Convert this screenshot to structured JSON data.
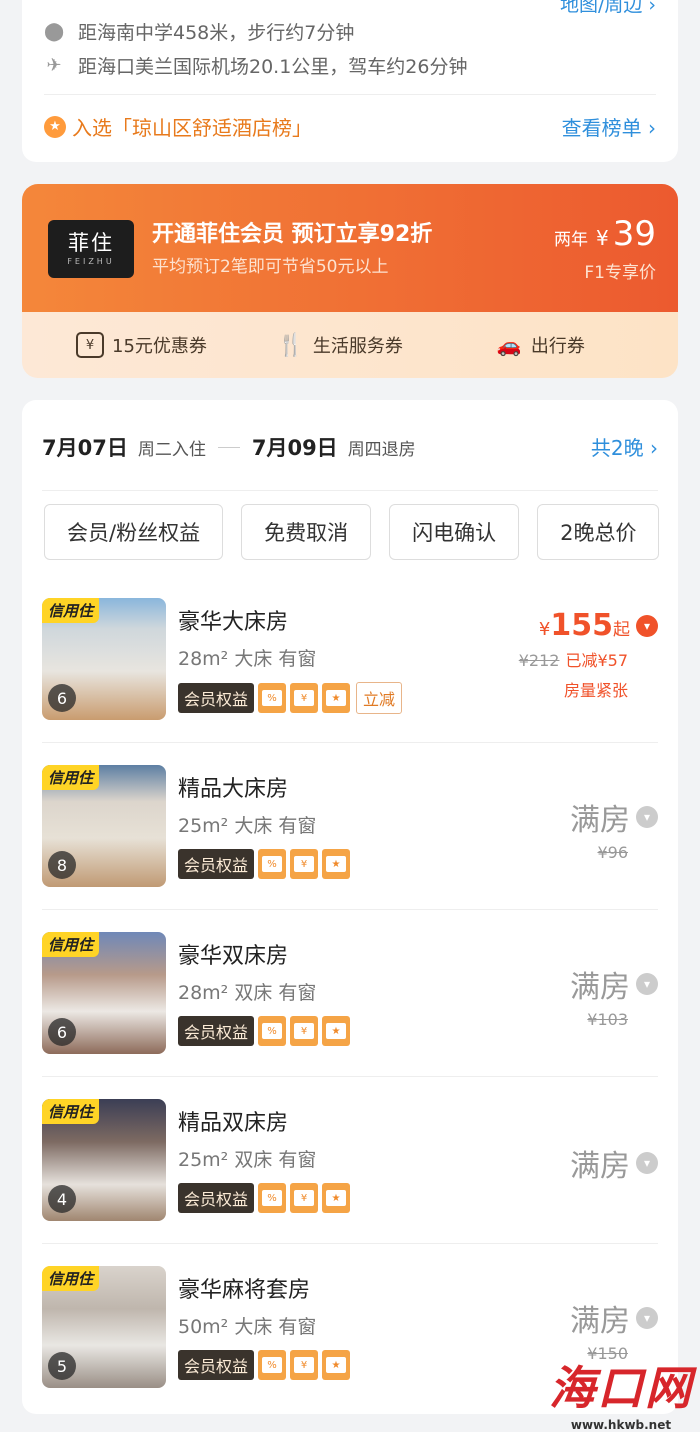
{
  "location": {
    "school": "距海南中学458米，步行约7分钟",
    "airport": "距海口美兰国际机场20.1公里，驾车约26分钟",
    "map_link": "地图/周边",
    "ranking": "入选「琼山区舒适酒店榜」",
    "ranking_link": "查看榜单"
  },
  "member": {
    "logo_cn": "菲住",
    "logo_en": "FEIZHU",
    "title": "开通菲住会员 预订立享92折",
    "subtitle": "平均预订2笔即可节省50元以上",
    "price_prefix": "两年",
    "currency": "¥",
    "price": "39",
    "price_note": "F1专享价",
    "perks": [
      "15元优惠券",
      "生活服务券",
      "出行券"
    ]
  },
  "dates": {
    "checkin_date": "7月07日",
    "checkin_label": "周二入住",
    "checkout_date": "7月09日",
    "checkout_label": "周四退房",
    "nights": "共2晚"
  },
  "filters": [
    "会员/粉丝权益",
    "免费取消",
    "闪电确认",
    "2晚总价"
  ],
  "room_badge": "信用住",
  "member_tag": "会员权益",
  "rooms": [
    {
      "name": "豪华大床房",
      "area": "28m²",
      "spec": "大床 有窗",
      "photos": "6",
      "price": "155",
      "price_suffix": "起",
      "orig": "¥212",
      "discount": "已减¥57",
      "status": "房量紧张",
      "extra_tag": "立减"
    },
    {
      "name": "精品大床房",
      "area": "25m²",
      "spec": "大床 有窗",
      "photos": "8",
      "full": "满房",
      "orig": "¥96"
    },
    {
      "name": "豪华双床房",
      "area": "28m²",
      "spec": "双床 有窗",
      "photos": "6",
      "full": "满房",
      "orig": "¥103"
    },
    {
      "name": "精品双床房",
      "area": "25m²",
      "spec": "双床 有窗",
      "photos": "4",
      "full": "满房"
    },
    {
      "name": "豪华麻将套房",
      "area": "50m²",
      "spec": "大床 有窗",
      "photos": "5",
      "full": "满房",
      "orig": "¥150"
    }
  ],
  "currency_symbol": "¥",
  "watermark": {
    "text": "海口网",
    "url": "www.hkwb.net"
  }
}
